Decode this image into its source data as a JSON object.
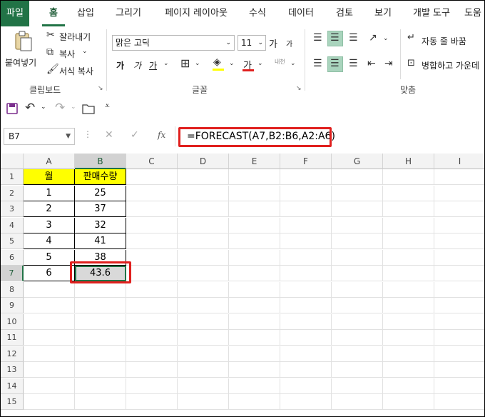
{
  "tabs": [
    "파일",
    "홈",
    "삽입",
    "그리기",
    "페이지 레이아웃",
    "수식",
    "데이터",
    "검토",
    "보기",
    "개발 도구",
    "도움"
  ],
  "clipboard": {
    "paste_label": "붙여넣기",
    "cut_label": "잘라내기",
    "copy_label": "복사",
    "format_painter_label": "서식 복사",
    "group_label": "클립보드"
  },
  "font": {
    "font_name": "맑은 고딕",
    "font_size": "11",
    "bold": "가",
    "italic": "가",
    "underline": "가",
    "increase": "가",
    "decrease": "가",
    "font_color_glyph": "가",
    "phonetic": "내천",
    "group_label": "글꼴"
  },
  "alignment": {
    "wrap_label": "자동 줄 바꿈",
    "merge_label": "병합하고 가운데",
    "group_label": "맞춤"
  },
  "formula_bar": {
    "name_box": "B7",
    "fx": "fx",
    "formula": "=FORECAST(A7,B2:B6,A2:A6)"
  },
  "columns": [
    "A",
    "B",
    "C",
    "D",
    "E",
    "F",
    "G",
    "H",
    "I"
  ],
  "rows": [
    "1",
    "2",
    "3",
    "4",
    "5",
    "6",
    "7",
    "8",
    "9",
    "10",
    "11",
    "12",
    "13",
    "14",
    "15"
  ],
  "table": {
    "headers": [
      "월",
      "판매수량"
    ],
    "data": [
      [
        "1",
        "25"
      ],
      [
        "2",
        "37"
      ],
      [
        "3",
        "32"
      ],
      [
        "4",
        "41"
      ],
      [
        "5",
        "38"
      ],
      [
        "6",
        "43.6"
      ]
    ]
  },
  "colors": {
    "accent": "#217346",
    "header_fill": "#ffff00",
    "selected_fill": "#d9d9d9",
    "highlight_border": "#e0201e"
  }
}
